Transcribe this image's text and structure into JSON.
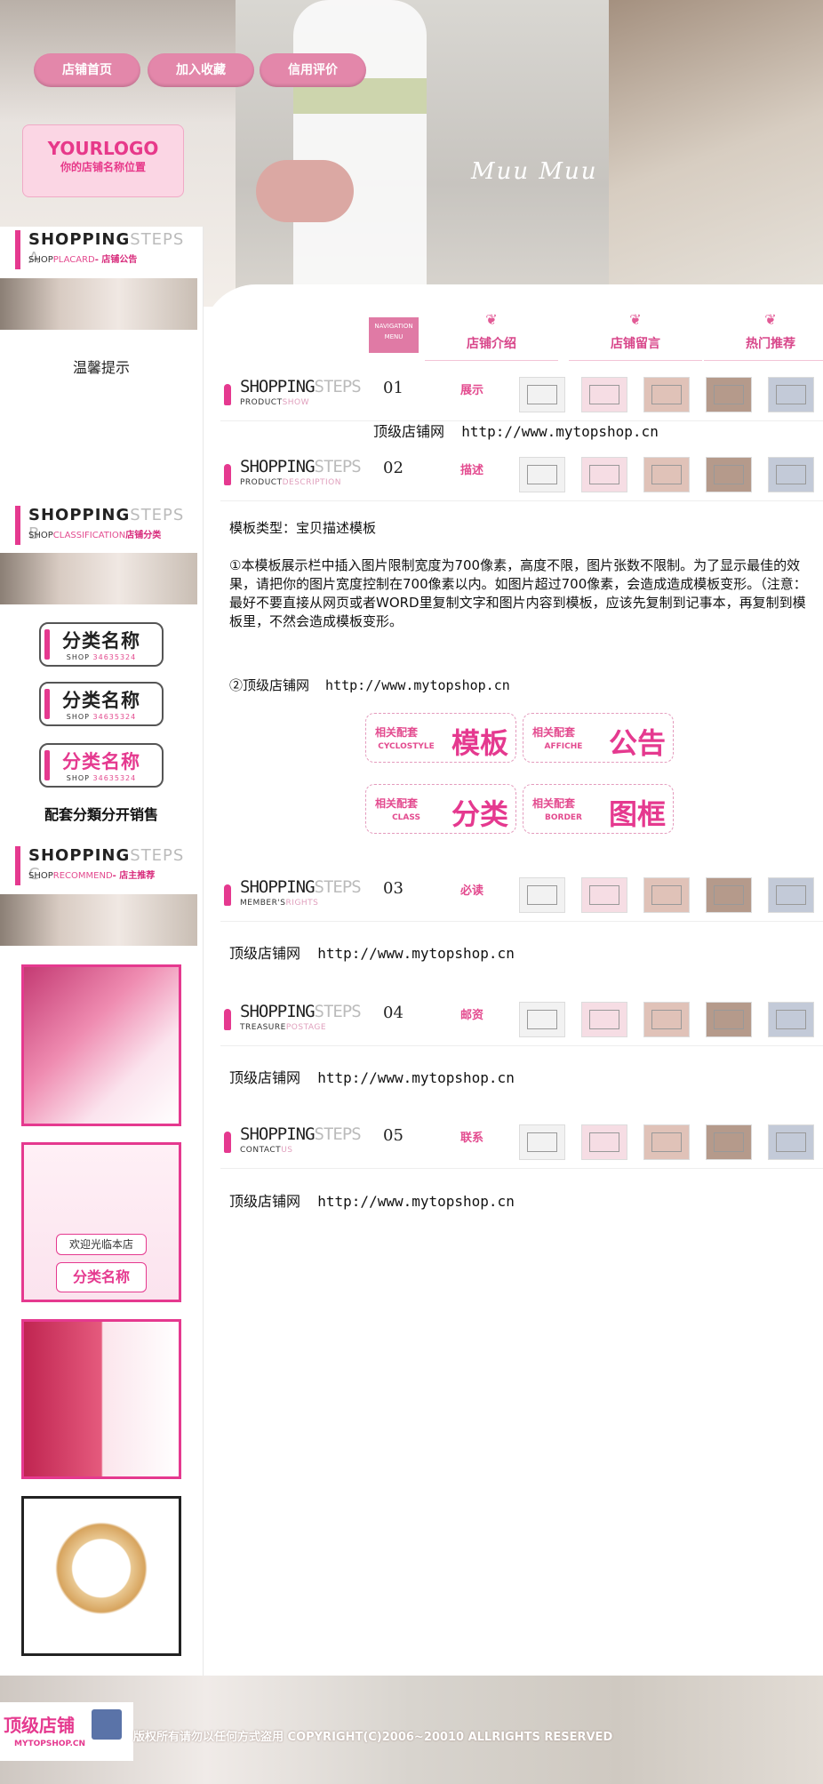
{
  "header": {
    "nav": [
      "店铺首页",
      "加入收藏",
      "信用评价"
    ],
    "logo_title": "YOURLOGO",
    "logo_subtitle": "你的店铺名称位置",
    "brand_watermark": "Muu Muu",
    "menu_label": "NAVIGATION MENU",
    "tabs": [
      "店铺介绍",
      "店铺留言",
      "热门推荐"
    ]
  },
  "sidebar": {
    "section_a": {
      "title_dark": "SHOPPING",
      "title_light": "STEPS A",
      "sub_dark": "SHOP",
      "sub_pink": "PLACARD",
      "sub_cn": "- 店铺公告"
    },
    "tip": "温馨提示",
    "section_b": {
      "title_dark": "SHOPPING",
      "title_light": "STEPS B",
      "sub_dark": "SHOP",
      "sub_pink": "CLASSIFICATION",
      "sub_cn": "店铺分类"
    },
    "categories": [
      {
        "name": "分类名称",
        "code_dark": "SHOP",
        "code_pink": "34635324"
      },
      {
        "name": "分类名称",
        "code_dark": "SHOP",
        "code_pink": "34635324"
      },
      {
        "name": "分类名称",
        "code_dark": "SHOP",
        "code_pink": "34635324"
      }
    ],
    "category_note": "配套分類分开销售",
    "section_c": {
      "title_dark": "SHOPPING",
      "title_light": "STEPS C",
      "sub_dark": "SHOP",
      "sub_pink": "RECOMMEND",
      "sub_cn": "- 店主推荐"
    },
    "promo_welcome": "欢迎光临本店",
    "promo_category": "分类名称"
  },
  "sections": [
    {
      "num": "01",
      "title_dark": "SHOPPING",
      "title_light": "STEPS",
      "sub_dark": "PRODUCT",
      "sub_pink": "SHOW",
      "cn": "展示",
      "body": "顶级店铺网  http://www.mytopshop.cn"
    },
    {
      "num": "02",
      "title_dark": "SHOPPING",
      "title_light": "STEPS",
      "sub_dark": "PRODUCT",
      "sub_pink": "DESCRIPTION",
      "cn": "描述"
    },
    {
      "num": "03",
      "title_dark": "SHOPPING",
      "title_light": "STEPS",
      "sub_dark": "MEMBER'S",
      "sub_pink": "RIGHTS",
      "cn": "必读",
      "body": "顶级店铺网  http://www.mytopshop.cn"
    },
    {
      "num": "04",
      "title_dark": "SHOPPING",
      "title_light": "STEPS",
      "sub_dark": "TREASURE",
      "sub_pink": "POSTAGE",
      "cn": "邮资",
      "body": "顶级店铺网  http://www.mytopshop.cn"
    },
    {
      "num": "05",
      "title_dark": "SHOPPING",
      "title_light": "STEPS",
      "sub_dark": "CONTACT",
      "sub_pink": "US",
      "cn": "联系",
      "body": "顶级店铺网  http://www.mytopshop.cn"
    }
  ],
  "description": {
    "type_line": "模板类型：宝贝描述模板",
    "paragraph": "①本模板展示栏中插入图片限制宽度为700像素，高度不限，图片张数不限制。为了显示最佳的效果，请把你的图片宽度控制在700像素以内。如图片超过700像素，会造成造成模板变形。（注意：最好不要直接从网页或者WORD里复制文字和图片内容到模板，应该先复制到记事本，再复制到模板里，不然会造成模板变形。",
    "link_line": "②顶级店铺网  http://www.mytopshop.cn"
  },
  "related_tags": [
    {
      "prefix": "相关配套",
      "en": "CYCLOSTYLE",
      "word": "模板"
    },
    {
      "prefix": "相关配套",
      "en": "AFFICHE",
      "word": "公告"
    },
    {
      "prefix": "相关配套",
      "en": "CLASS",
      "word": "分类"
    },
    {
      "prefix": "相关配套",
      "en": "BORDER",
      "word": "图框"
    }
  ],
  "footer": {
    "logo_cn": "顶级店铺",
    "logo_en": "MYTOPSHOP.CN",
    "copyright": "版权所有请勿以任何方式盗用    COPYRIGHT(C)2006~20010 ALLRIGHTS RESERVED"
  },
  "colors": {
    "accent": "#e5398f",
    "nav_pink": "#e387aa"
  }
}
